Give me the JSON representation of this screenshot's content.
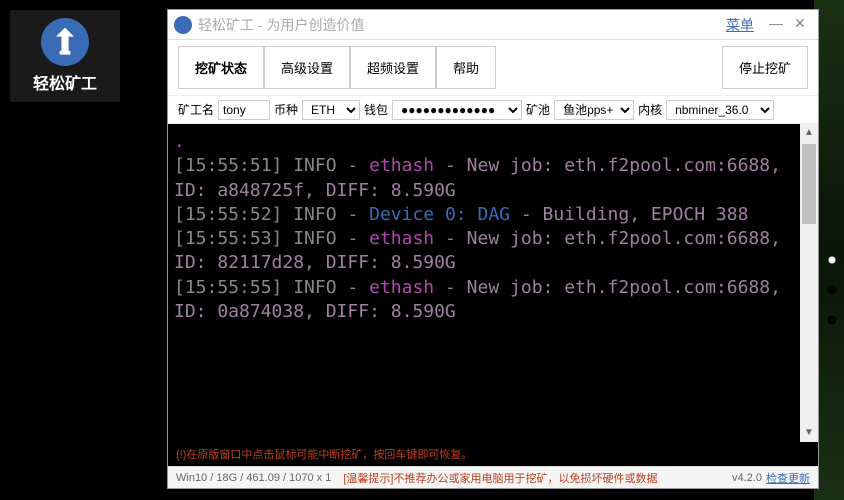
{
  "desktop_icon": {
    "label": "轻松矿工"
  },
  "window": {
    "title": "轻松矿工 - 为用户创造价值",
    "menu": "菜单"
  },
  "toolbar": {
    "mining_status": "挖矿状态",
    "advanced": "高级设置",
    "overclock": "超频设置",
    "help": "帮助",
    "stop_mining": "停止挖矿"
  },
  "fields": {
    "miner_name_label": "矿工名",
    "miner_name": "tony",
    "coin_label": "币种",
    "coin": "ETH",
    "wallet_label": "钱包",
    "wallet": "●●●●●●●●●●●●●",
    "pool_label": "矿池",
    "pool": "鱼池pps+",
    "kernel_label": "内核",
    "kernel": "nbminer_36.0"
  },
  "console_lines": [
    {
      "ts": "[15:55:51]",
      "level": "INFO",
      "kind": "job",
      "text1": "ethash",
      "text2": "New job: eth.f2pool.com:6688, ID: a848725f, DIFF: 8.590G"
    },
    {
      "ts": "[15:55:52]",
      "level": "INFO",
      "kind": "device",
      "text1": "Device 0: DAG",
      "text2": "Building, EPOCH 388"
    },
    {
      "ts": "[15:55:53]",
      "level": "INFO",
      "kind": "job",
      "text1": "ethash",
      "text2": "New job: eth.f2pool.com:6688, ID: 82117d28, DIFF: 8.590G"
    },
    {
      "ts": "[15:55:55]",
      "level": "INFO",
      "kind": "job",
      "text1": "ethash",
      "text2": "New job: eth.f2pool.com:6688, ID: 0a874038, DIFF: 8.590G"
    }
  ],
  "warn_line": "(!)在原版窗口中点击鼠标可能中断挖矿，按回车键即可恢复。",
  "status": {
    "sysinfo": "Win10  /  18G / 461.09 / 1070 x 1",
    "tip": "[温馨提示]不推荐办公或家用电脑用于挖矿，以免损坏硬件或数据",
    "version": "v4.2.0",
    "check_update": "检查更新"
  }
}
